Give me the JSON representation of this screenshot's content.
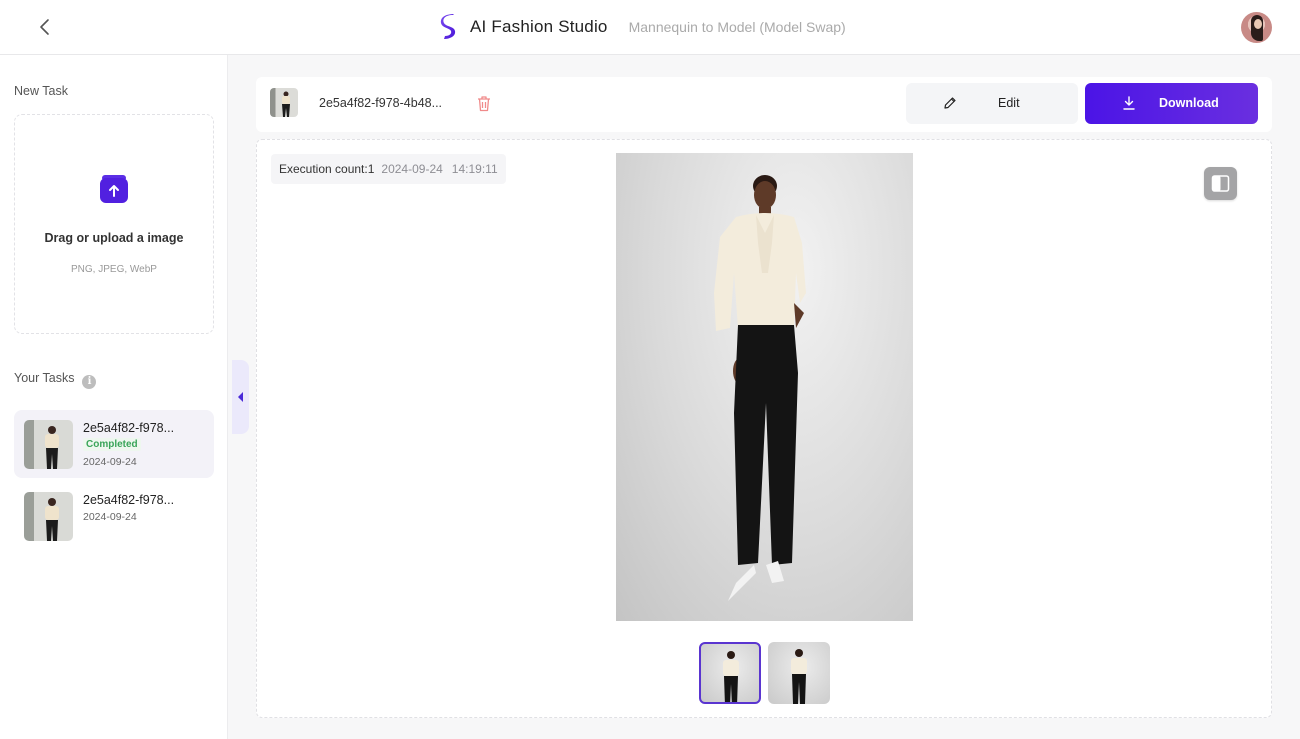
{
  "header": {
    "back_icon": "chevron-left-icon",
    "brand_title": "AI Fashion Studio",
    "subtitle": "Mannequin to Model (Model Swap)",
    "brand_color": "#5b2ee6"
  },
  "sidebar": {
    "new_task_label": "New Task",
    "upload": {
      "title": "Drag or upload a image",
      "hint": "PNG, JPEG, WebP",
      "icon": "upload-icon"
    },
    "your_tasks_label": "Your Tasks",
    "tasks": [
      {
        "name": "2e5a4f82-f978...",
        "status": "Completed",
        "date": "2024-09-24",
        "active": true
      },
      {
        "name": "2e5a4f82-f978...",
        "date": "2024-09-24",
        "active": false
      }
    ]
  },
  "toolbar": {
    "task_name": "2e5a4f82-f978-4b48...",
    "edit_label": "Edit",
    "download_label": "Download",
    "accent_color": "#4b14e6"
  },
  "result": {
    "execution_label": "Execution count:1",
    "date": "2024-09-24",
    "time": "14:19:11",
    "image_alt": "Model wearing cream pussy-bow blouse and black flared trousers with white pointed heels",
    "thumbnails": [
      {
        "alt": "Result variant 1",
        "selected": true
      },
      {
        "alt": "Result variant 2",
        "selected": false
      }
    ]
  }
}
